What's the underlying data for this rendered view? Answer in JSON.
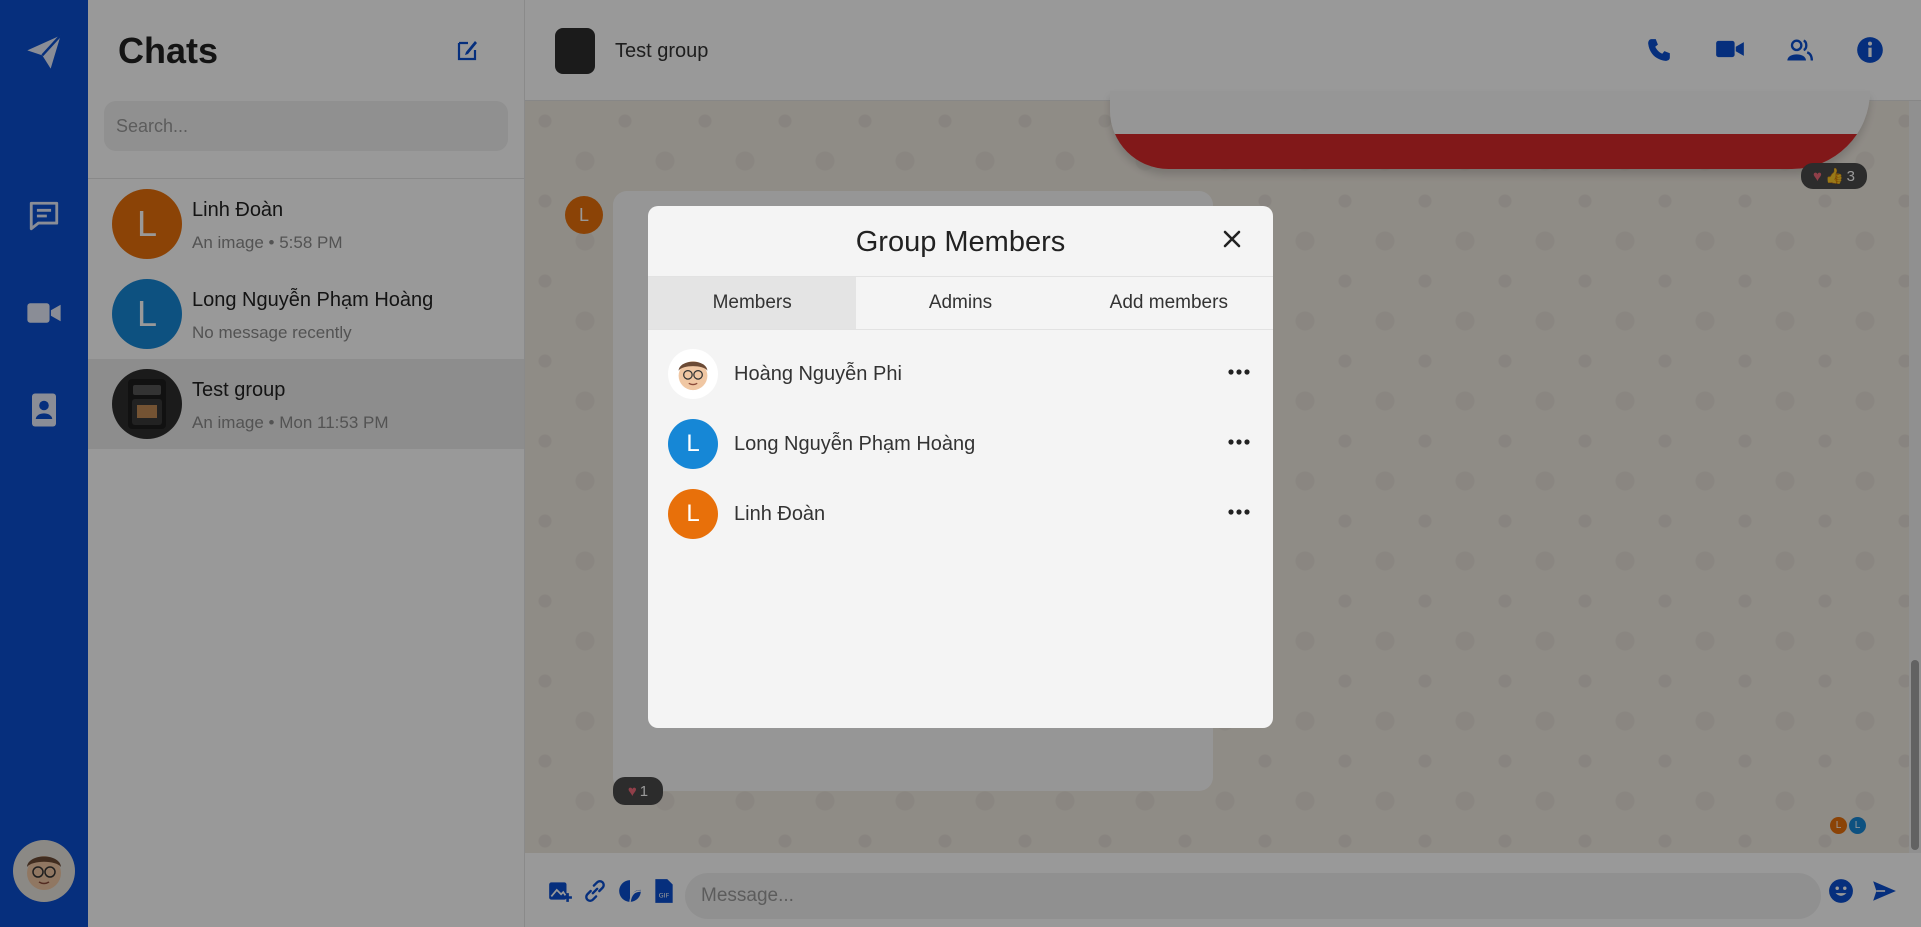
{
  "sidebar": {
    "title": "Chats",
    "search_placeholder": "Search...",
    "chats": [
      {
        "avatar_letter": "L",
        "avatar_color": "#e8700a",
        "name": "Linh Đoàn",
        "preview": "An image • 5:58 PM"
      },
      {
        "avatar_letter": "L",
        "avatar_color": "#1687d6",
        "name": "Long Nguyễn Phạm Hoàng",
        "preview": "No message recently"
      },
      {
        "avatar_letter": "",
        "avatar_color": "#2e2e2e",
        "name": "Test group",
        "preview": "An image • Mon 11:53 PM"
      }
    ]
  },
  "rail": {
    "accent": "#0b4fd0",
    "icons": [
      "paper-plane-icon",
      "chat-icon",
      "video-icon",
      "contacts-icon"
    ]
  },
  "header": {
    "title": "Test group",
    "icons": [
      "phone-icon",
      "video-call-icon",
      "members-icon",
      "info-icon"
    ]
  },
  "chat": {
    "reaction_top_count": "3",
    "reaction_bottom_count": "1",
    "message_avatar_letter": "L",
    "seen_by": [
      {
        "letter": "L",
        "color": "#e8700a"
      },
      {
        "letter": "L",
        "color": "#1687d6"
      }
    ]
  },
  "composer": {
    "placeholder": "Message..."
  },
  "modal": {
    "title": "Group Members",
    "tabs": [
      "Members",
      "Admins",
      "Add members"
    ],
    "active_tab": "Members",
    "members": [
      {
        "name": "Hoàng Nguyễn Phi",
        "avatar_letter": "",
        "avatar_color": "#ffffff"
      },
      {
        "name": "Long Nguyễn Phạm Hoàng",
        "avatar_letter": "L",
        "avatar_color": "#1687d6"
      },
      {
        "name": "Linh Đoàn",
        "avatar_letter": "L",
        "avatar_color": "#e8700a"
      }
    ]
  }
}
